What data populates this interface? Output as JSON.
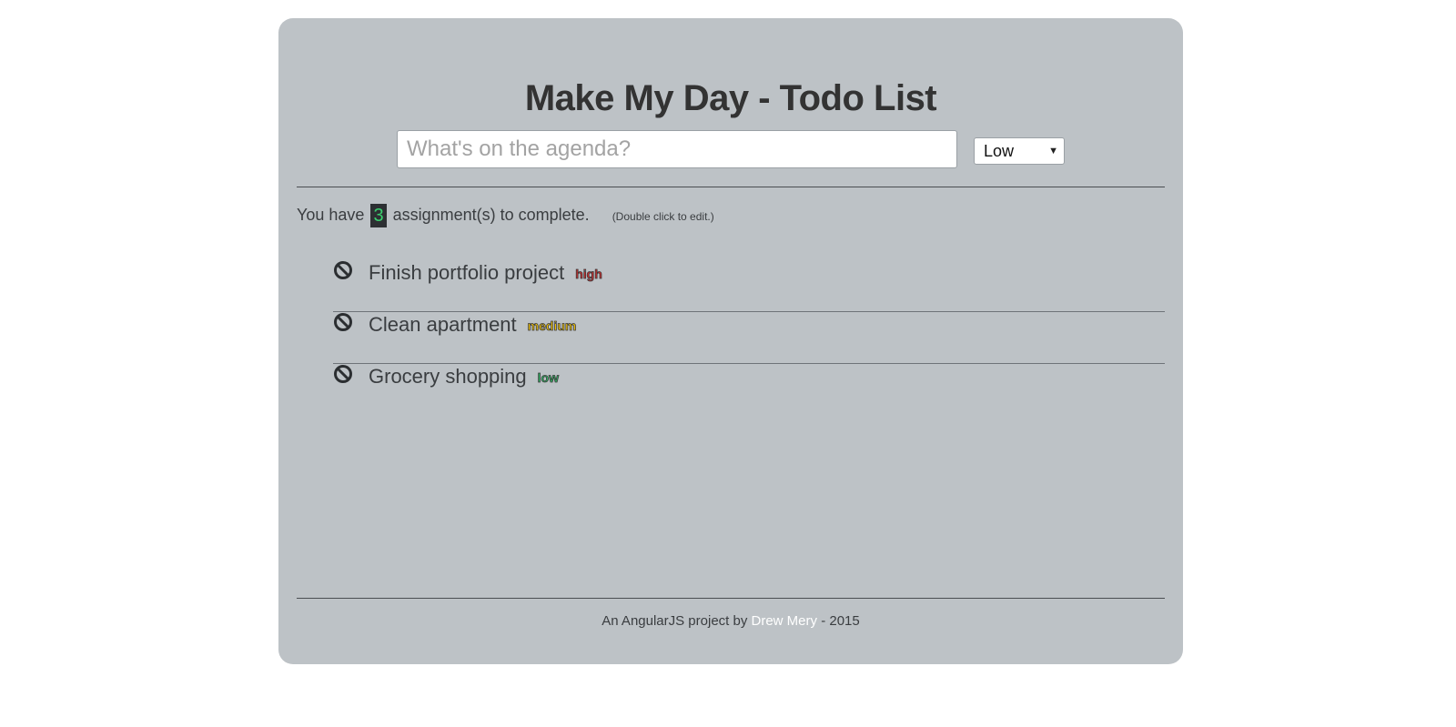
{
  "header": {
    "title": "Make My Day - Todo List"
  },
  "new_todo": {
    "placeholder": "What's on the agenda?",
    "value": ""
  },
  "priority_select": {
    "selected": "Low",
    "caret": "▼"
  },
  "summary": {
    "prefix": "You have",
    "count": "3",
    "suffix": "assignment(s) to complete.",
    "hint": "(Double click to edit.)"
  },
  "todos": [
    {
      "text": "Finish portfolio project",
      "priority": "high",
      "color": "#cc2e2e",
      "icon": "ban-icon"
    },
    {
      "text": "Clean apartment",
      "priority": "medium",
      "color": "#f0c20a",
      "icon": "ban-icon"
    },
    {
      "text": "Grocery shopping",
      "priority": "low",
      "color": "#2fb564",
      "icon": "ban-icon"
    }
  ],
  "footer": {
    "prefix": "An AngularJS project by",
    "author": "Drew Mery",
    "suffix": "- 2015"
  },
  "colors": {
    "card_background": "#bdc2c6",
    "count_text": "#3bd16f",
    "count_background": "#2d3033",
    "link": "#ffffff"
  }
}
